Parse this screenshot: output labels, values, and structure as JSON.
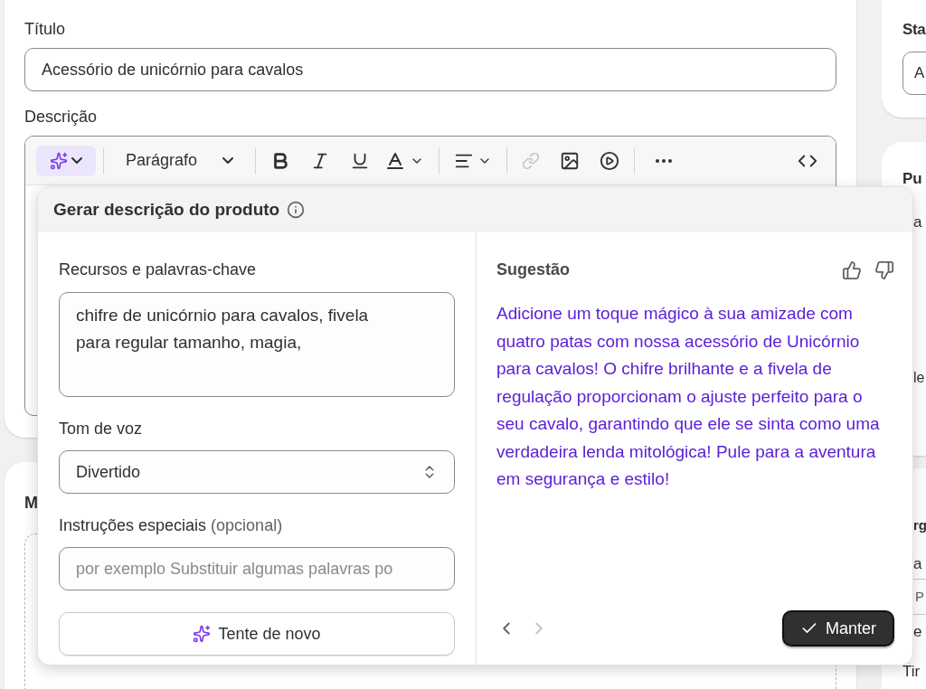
{
  "title_field": {
    "label": "Título",
    "value": "Acessório de unicórnio para cavalos"
  },
  "description": {
    "label": "Descrição",
    "ai_button": {
      "selected": true
    },
    "paragraph_style": "Parágrafo",
    "link_button": {
      "disabled": true
    }
  },
  "media_card": {
    "heading": "M"
  },
  "sidebar": {
    "status_card": {
      "heading": "Sta",
      "select_value": "A"
    },
    "second_card": {
      "heading": "Pu",
      "line_1": "a",
      "line_2": "le",
      "subheading": "rg",
      "line_3": "a",
      "field_value": "P",
      "line_4": "e",
      "line_5": "Tir"
    }
  },
  "generate_popover": {
    "title": "Gerar descrição do produto",
    "features": {
      "label": "Recursos e palavras-chave",
      "value": "chifre de unicórnio para cavalos, fivela para regular tamanho, magia,"
    },
    "tone": {
      "label": "Tom de voz",
      "value": "Divertido"
    },
    "instructions": {
      "label": "Instruções especiais",
      "optional": "(opcional)",
      "placeholder": "por exemplo Substituir algumas palavras po"
    },
    "retry_button": "Tente de novo",
    "suggestion": {
      "label": "Sugestão",
      "text": "Adicione um toque mágico à sua amizade com quatro patas com nossa acessório de Unicórnio para cavalos! O chifre brilhante e a fivela de regulação proporcionam o ajuste perfeito para o seu cavalo, garantindo que ele se sinta como uma verdadeira lenda mitológica! Pule para a aventura em segurança e estilo!"
    },
    "previous_disabled": false,
    "next_disabled": true,
    "keep_button": "Manter"
  }
}
